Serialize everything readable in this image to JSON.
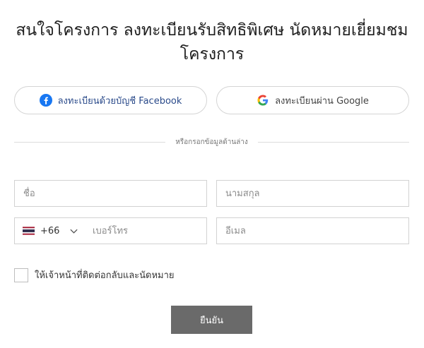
{
  "form": {
    "title": "สนใจโครงการ ลงทะเบียนรับสิทธิพิเศษ นัดหมายเยี่ยมชมโครงการ",
    "facebook_label": "ลงทะเบียนด้วยบัญชี Facebook",
    "google_label": "ลงทะเบียนผ่าน Google",
    "divider_text": "หรือกรอกข้อมูลด้านล่าง",
    "first_name_placeholder": "ชื่อ",
    "last_name_placeholder": "นามสกุล",
    "country_code": "+66",
    "country_flag": "thailand-flag",
    "phone_placeholder": "เบอร์โทร",
    "email_placeholder": "อีเมล",
    "consent_label": "ให้เจ้าหน้าที่ติดต่อกลับและนัดหมาย",
    "consent_checked": false,
    "submit_label": "ยืนยัน"
  },
  "colors": {
    "facebook_blue": "#1877F2",
    "submit_bg": "#6a6a6a",
    "border": "#d2d2d2"
  }
}
